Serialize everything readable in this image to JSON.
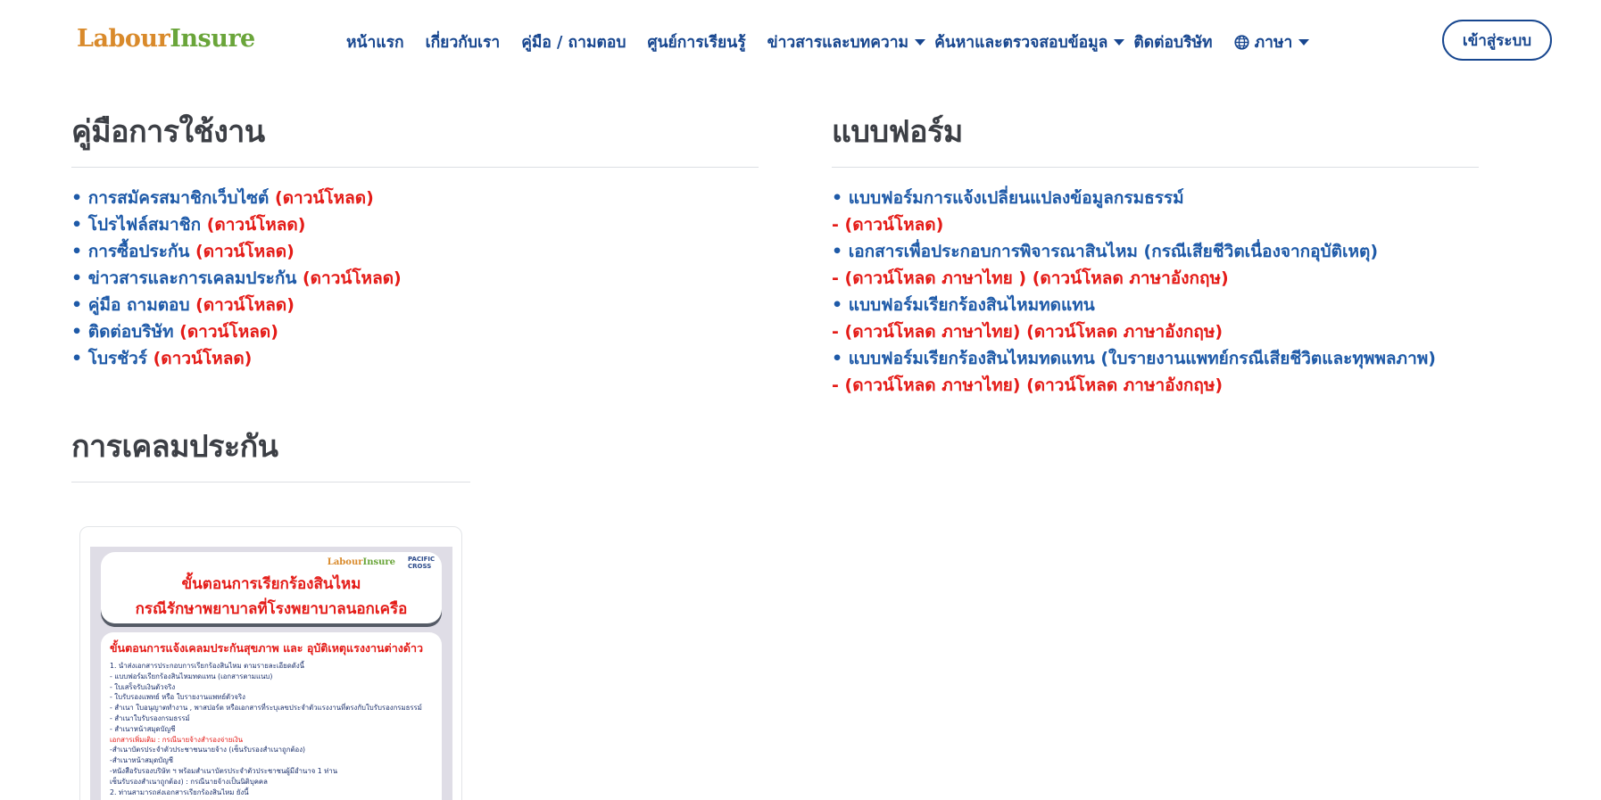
{
  "header": {
    "logo_part1": "Labour",
    "logo_part2": "Insure",
    "nav": [
      {
        "label": "หน้าแรก"
      },
      {
        "label": "เกี่ยวกับเรา"
      },
      {
        "label": "คู่มือ / ถามตอบ"
      },
      {
        "label": "ศูนย์การเรียนรู้"
      },
      {
        "label": "ข่าวสารและบทความ"
      },
      {
        "label": "ค้นหาและตรวจสอบข้อมูล"
      },
      {
        "label": "ติดต่อบริษัท"
      },
      {
        "label": "ภาษา"
      }
    ],
    "login_label": "เข้าสู่ระบบ"
  },
  "manual": {
    "title": "คู่มือการใช้งาน",
    "items": [
      {
        "label": "• การสมัครสมาชิกเว็บไซต์",
        "link": "(ดาวน์โหลด)"
      },
      {
        "label": "• โปรไฟล์สมาชิก",
        "link": "(ดาวน์โหลด)"
      },
      {
        "label": "• การซื้อประกัน",
        "link": "(ดาวน์โหลด)"
      },
      {
        "label": "• ข่าวสารและการเคลมประกัน",
        "link": "(ดาวน์โหลด)"
      },
      {
        "label": "• คู่มือ ถามตอบ",
        "link": "(ดาวน์โหลด)"
      },
      {
        "label": "• ติดต่อบริษัท",
        "link": "(ดาวน์โหลด)"
      },
      {
        "label": "• โบรชัวร์",
        "link": "(ดาวน์โหลด)"
      }
    ]
  },
  "forms": {
    "title": "แบบฟอร์ม",
    "items": [
      {
        "label": "• แบบฟอร์มการแจ้งเปลี่ยนแปลงข้อมูลกรมธรรม์",
        "prefix": "- ",
        "link1": "(ดาวน์โหลด)",
        "link2": ""
      },
      {
        "label": "• เอกสารเพื่อประกอบการพิจารณาสินไหม (กรณีเสียชีวิตเนื่องจากอุบัติเหตุ)",
        "prefix": "- ",
        "link1": "(ดาวน์โหลด ภาษาไทย )",
        "link2": "(ดาวน์โหลด ภาษาอังกฤษ)"
      },
      {
        "label": "• แบบฟอร์มเรียกร้องสินไหมทดแทน",
        "prefix": "- ",
        "link1": "(ดาวน์โหลด ภาษาไทย)",
        "link2": "(ดาวน์โหลด ภาษาอังกฤษ)"
      },
      {
        "label": "• แบบฟอร์มเรียกร้องสินไหมทดแทน (ใบรายงานแพทย์กรณีเสียชีวิตและทุพพลภาพ)",
        "prefix": "- ",
        "link1": "(ดาวน์โหลด ภาษาไทย)",
        "link2": "(ดาวน์โหลด ภาษาอังกฤษ)"
      }
    ]
  },
  "claims": {
    "title": "การเคลมประกัน",
    "poster": {
      "logo_part1": "Labour",
      "logo_part2": "Insure",
      "partner": "PACIFIC CROSS",
      "title1": "ขั้นตอนการเรียกร้องสินไหม",
      "title2": "กรณีรักษาพยาบาลที่โรงพยาบาลนอกเครือ",
      "subtitle": "ขั้นตอนการแจ้งเคลมประกันสุขภาพ และ อุบัติเหตุแรงงานต่างด้าว",
      "lines": [
        {
          "text": "1. นำส่งเอกสารประกอบการเรียกร้องสินไหม ตามรายละเอียดดังนี้",
          "red": false
        },
        {
          "text": "- แบบฟอร์มเรียกร้องสินไหมทดแทน (เอกสารตามแนบ)",
          "red": false
        },
        {
          "text": "- ใบเสร็จรับเงินตัวจริง",
          "red": false
        },
        {
          "text": "- ใบรับรองแพทย์ หรือ ใบรายงานแพทย์ตัวจริง",
          "red": false
        },
        {
          "text": "- สำเนา ใบอนุญาตทำงาน , พาสปอร์ต หรือเอกสารที่ระบุเลขประจำตัวแรงงานที่ตรงกับใบรับรองกรมธรรม์",
          "red": false
        },
        {
          "text": "- สำเนาใบรับรองกรมธรรม์",
          "red": false
        },
        {
          "text": "- สำเนาหน้าสมุดบัญชี",
          "red": false
        },
        {
          "text": "เอกสารเพิ่มเติม : กรณีนายจ้างสำรองจ่ายเงิน",
          "red": true
        },
        {
          "text": "-สำเนาบัตรประจำตัวประชาชนนายจ้าง (เซ็นรับรองสำเนาถูกต้อง)",
          "red": false
        },
        {
          "text": "-สำเนาหน้าสมุดบัญชี",
          "red": false
        },
        {
          "text": "-หนังสือรับรองบริษัท ฯ พร้อมสำเนาบัตรประจำตัวประชาชนผู้มีอำนาจ 1 ท่าน",
          "red": false
        },
        {
          "text": "  เซ็นรับรองสำเนาถูกต้อง) : กรณีนายจ้างเป็นนิติบุคคล",
          "red": false
        },
        {
          "text": "2. ท่านสามารถส่งเอกสารเรียกร้องสินไหม ยังนี้",
          "red": false
        }
      ]
    }
  }
}
